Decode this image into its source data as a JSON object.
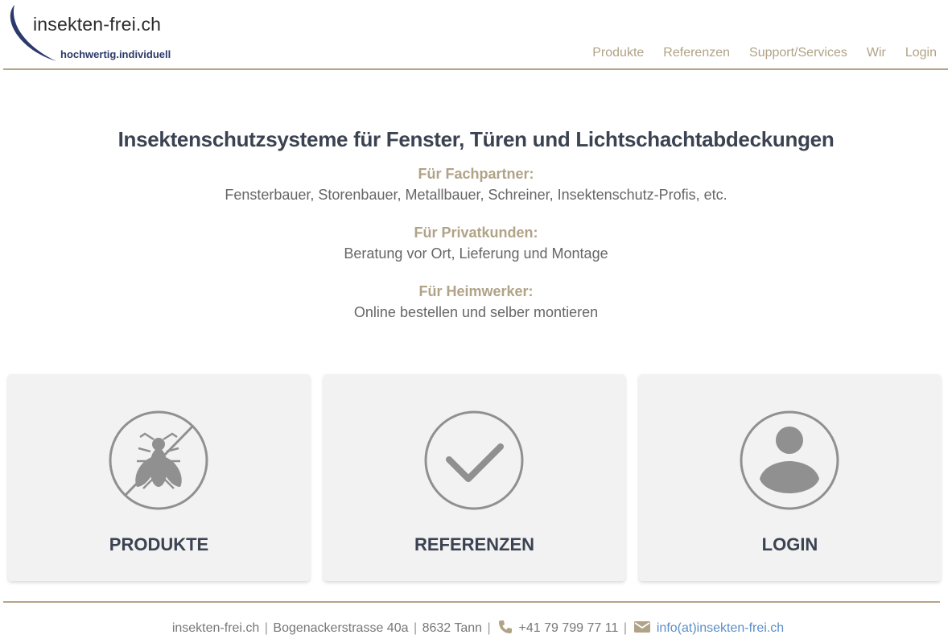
{
  "header": {
    "logo_name": "insekten-frei.ch",
    "logo_tagline": "hochwertig.individuell",
    "nav": [
      "Produkte",
      "Referenzen",
      "Support/Services",
      "Wir",
      "Login"
    ]
  },
  "hero": {
    "title": "Insektenschutzsysteme für Fenster, Türen und Lichtschachtabdeckungen",
    "segments": [
      {
        "title": "Für Fachpartner:",
        "text": "Fensterbauer, Storenbauer, Metallbauer, Schreiner, Insektenschutz-Profis, etc."
      },
      {
        "title": "Für Privatkunden:",
        "text": "Beratung vor Ort, Lieferung und Montage"
      },
      {
        "title": "Für Heimwerker:",
        "text": "Online bestellen und selber montieren"
      }
    ]
  },
  "cards": [
    {
      "label": "PRODUKTE",
      "icon": "no-insect-icon"
    },
    {
      "label": "REFERENZEN",
      "icon": "checkmark-icon"
    },
    {
      "label": "LOGIN",
      "icon": "user-icon"
    }
  ],
  "footer": {
    "company": "insekten-frei.ch",
    "address": "Bogenackerstrasse 40a",
    "city": "8632 Tann",
    "phone": "+41 79 799 77 11",
    "email": "info(at)insekten-frei.ch",
    "separator": "|"
  },
  "colors": {
    "accent": "#b0a387",
    "heading": "#3b4352",
    "card_bg": "#f2f2f2",
    "link": "#5b8fc9"
  }
}
